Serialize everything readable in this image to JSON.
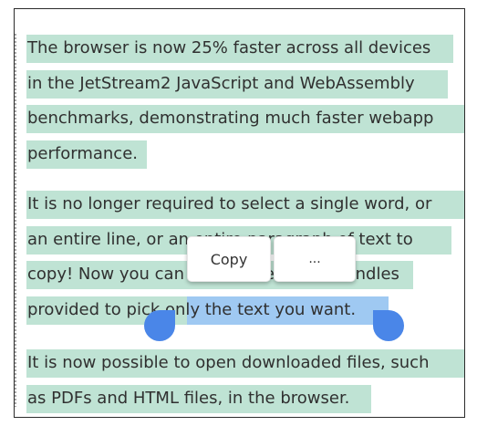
{
  "paragraphs": [
    {
      "id": "p1",
      "lines": [
        {
          "text": "The browser is now 25% faster across all devices"
        },
        {
          "text": "in the JetStream2 JavaScript and WebAssembly"
        },
        {
          "text": "benchmarks, demonstrating much faster webapp"
        },
        {
          "text": "performance."
        }
      ]
    },
    {
      "id": "p2",
      "lines": [
        {
          "text": "It is no longer required to select a single word, or"
        },
        {
          "text": "an entire line, or an entire paragraph of text to"
        },
        {
          "text": "copy! Now you can use the selection handles"
        },
        {
          "text_before": "provided to pick ",
          "text_selected": "only the text you want",
          "text_after": "."
        }
      ]
    },
    {
      "id": "p3",
      "lines": [
        {
          "text": "It is now possible to open downloaded files, such"
        },
        {
          "text": "as PDFs and HTML files, in the browser."
        }
      ]
    }
  ],
  "context_menu": {
    "copy_label": "Copy",
    "more_label": "..."
  },
  "colors": {
    "highlight_existing": "#bfe3d4",
    "highlight_active": "#9fc9f2",
    "handle": "#4a86e8",
    "text": "#303030"
  }
}
